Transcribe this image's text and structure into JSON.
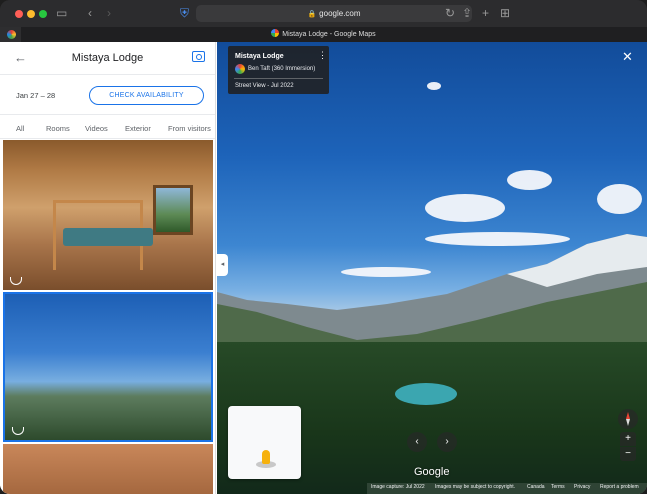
{
  "browser": {
    "url": "google.com",
    "tab_title": "Mistaya Lodge - Google Maps"
  },
  "panel": {
    "title": "Mistaya Lodge",
    "dates": "Jan 27 – 28",
    "check_availability": "CHECK AVAILABILITY",
    "filters": [
      "All",
      "Rooms",
      "Videos",
      "Exterior",
      "From visitors"
    ]
  },
  "streetview": {
    "place": "Mistaya Lodge",
    "author": "Ben Taft (360 Immersion)",
    "date": "Street View - Jul 2022",
    "logo": "Google",
    "footer": [
      "Image capture: Jul 2022",
      "Images may be subject to copyright.",
      "Canada",
      "Terms",
      "Privacy",
      "Report a problem"
    ]
  },
  "colors": {
    "accent": "#1a73e8",
    "traffic_red": "#ff5f57",
    "traffic_yellow": "#febc2e",
    "traffic_green": "#28c840"
  },
  "icons": {
    "back": "arrow-left-icon",
    "add_photo": "camera-add-icon",
    "close": "close-icon",
    "pano": "360-panorama-icon"
  }
}
